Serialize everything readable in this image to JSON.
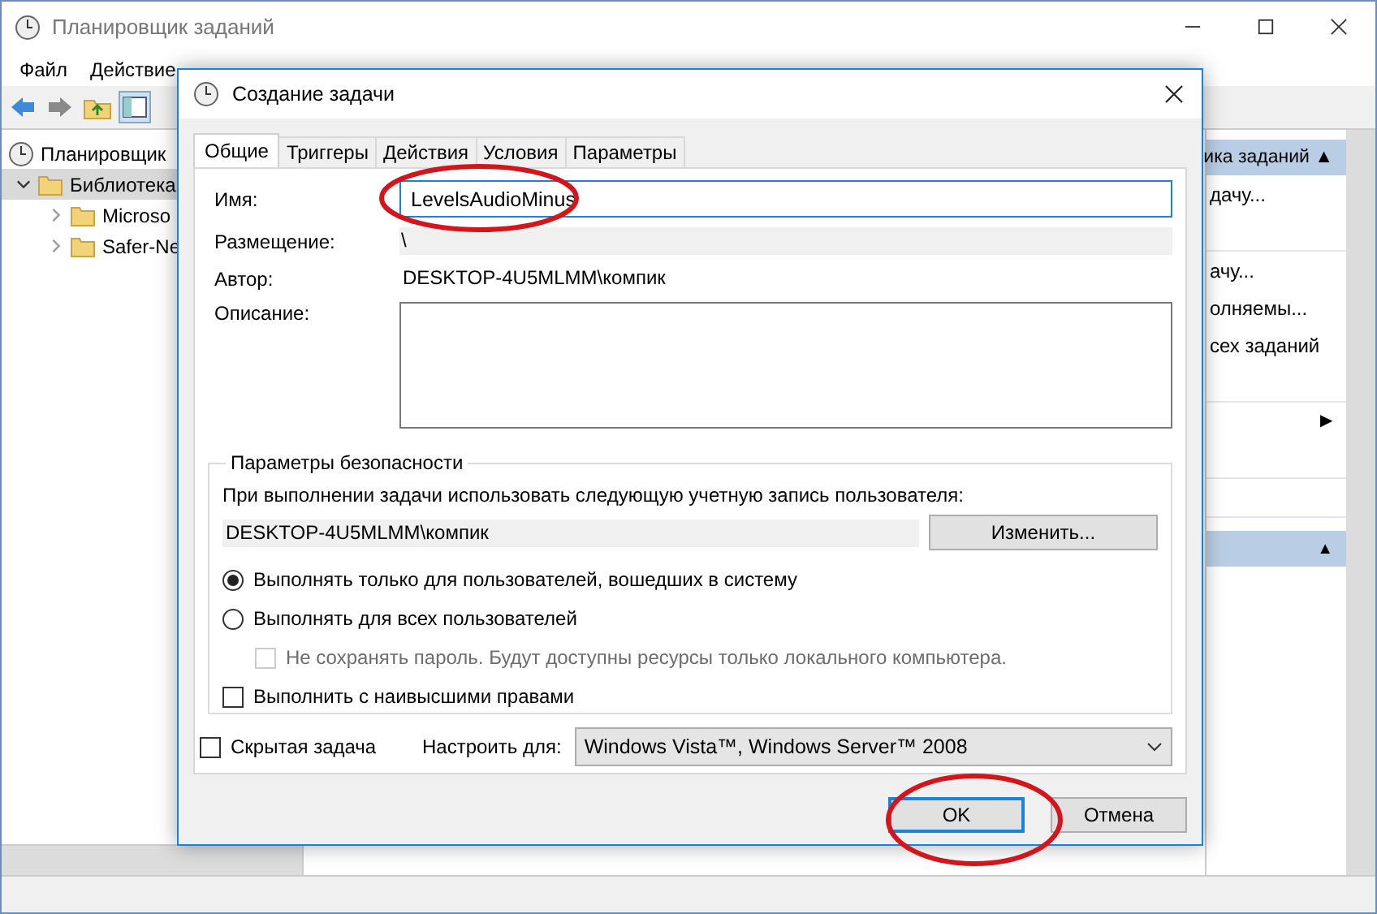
{
  "window": {
    "title": "Планировщик заданий"
  },
  "menu": [
    "Файл",
    "Действие"
  ],
  "tree": [
    {
      "label": "Планировщик",
      "children": [
        {
          "label": "Библиотека",
          "expanded": true,
          "selected": true,
          "children": [
            {
              "label": "Microso",
              "expanded": false
            },
            {
              "label": "Safer-Ne",
              "expanded": false
            }
          ]
        }
      ]
    }
  ],
  "actions_panel": {
    "header": "ика заданий ▲",
    "items": [
      {
        "kind": "text",
        "label": "дачу..."
      },
      {
        "kind": "blank"
      },
      {
        "kind": "text",
        "label": "ачу..."
      },
      {
        "kind": "text",
        "label": "олняемы..."
      },
      {
        "kind": "text",
        "label": "сех заданий"
      },
      {
        "kind": "blank"
      },
      {
        "kind": "arrow",
        "label": "▶"
      },
      {
        "kind": "blank"
      },
      {
        "kind": "blank"
      }
    ],
    "header_2": "▲"
  },
  "dialog": {
    "title": "Создание задачи",
    "tabs": [
      {
        "label": "Общие",
        "selected": true
      },
      {
        "label": "Триггеры",
        "selected": false
      },
      {
        "label": "Действия",
        "selected": false
      },
      {
        "label": "Условия",
        "selected": false
      },
      {
        "label": "Параметры",
        "selected": false
      }
    ],
    "name": {
      "label": "Имя:",
      "value": "LevelsAudioMinus"
    },
    "location": {
      "label": "Размещение:",
      "value": "\\"
    },
    "author": {
      "label": "Автор:",
      "value": "DESKTOP-4U5MLMM\\компик"
    },
    "description": {
      "label": "Описание:"
    },
    "security": {
      "title": "Параметры безопасности",
      "prompt": "При выполнении задачи использовать следующую учетную запись пользователя:",
      "account": "DESKTOP-4U5MLMM\\компик",
      "change_button": "Изменить...",
      "radios": [
        {
          "label": "Выполнять только для пользователей, вошедших в систему",
          "selected": true
        },
        {
          "label": "Выполнять для всех пользователей",
          "selected": false
        }
      ],
      "no_password": {
        "label": "Не сохранять пароль. Будут доступны ресурсы только локального компьютера.",
        "checked": false,
        "disabled": true
      },
      "highest": {
        "label": "Выполнить с наивысшими правами",
        "checked": false
      }
    },
    "hidden": {
      "label": "Скрытая задача",
      "checked": false
    },
    "configure": {
      "label": "Настроить для:",
      "value": "Windows Vista™, Windows Server™ 2008"
    },
    "buttons": [
      {
        "label": "OK",
        "default": true
      },
      {
        "label": "Отмена",
        "default": false
      }
    ]
  }
}
